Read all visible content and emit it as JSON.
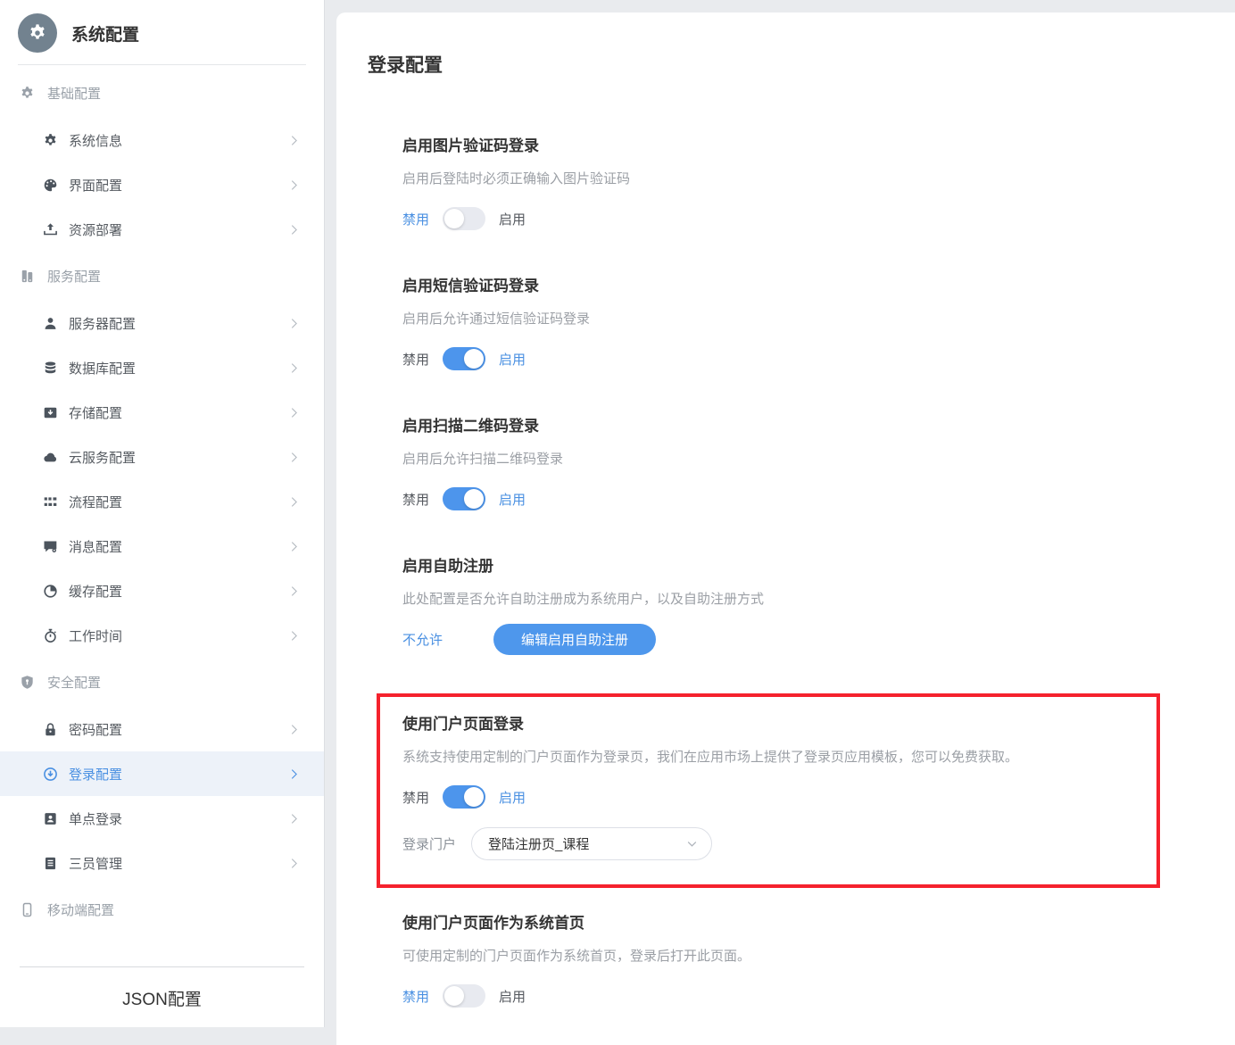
{
  "sidebar": {
    "app_title": "系统配置",
    "app_icon": "app-gear-icon",
    "footer_label": "JSON配置",
    "sections": [
      {
        "label": "基础配置",
        "icon": "gear-icon",
        "items": [
          {
            "label": "系统信息",
            "icon": "gear-icon"
          },
          {
            "label": "界面配置",
            "icon": "palette-icon"
          },
          {
            "label": "资源部署",
            "icon": "deploy-icon"
          }
        ]
      },
      {
        "label": "服务配置",
        "icon": "server-icon",
        "items": [
          {
            "label": "服务器配置",
            "icon": "service-person-icon"
          },
          {
            "label": "数据库配置",
            "icon": "database-icon"
          },
          {
            "label": "存储配置",
            "icon": "storage-icon"
          },
          {
            "label": "云服务配置",
            "icon": "cloud-icon"
          },
          {
            "label": "流程配置",
            "icon": "flow-icon"
          },
          {
            "label": "消息配置",
            "icon": "message-icon"
          },
          {
            "label": "缓存配置",
            "icon": "cache-icon"
          },
          {
            "label": "工作时间",
            "icon": "timer-icon"
          }
        ]
      },
      {
        "label": "安全配置",
        "icon": "shield-icon",
        "items": [
          {
            "label": "密码配置",
            "icon": "lock-icon"
          },
          {
            "label": "登录配置",
            "icon": "login-icon",
            "selected": true
          },
          {
            "label": "单点登录",
            "icon": "sso-icon"
          },
          {
            "label": "三员管理",
            "icon": "roles-icon"
          }
        ]
      },
      {
        "label": "移动端配置",
        "icon": "mobile-icon",
        "items": []
      }
    ]
  },
  "main": {
    "title": "登录配置",
    "toggle_labels": {
      "off": "禁用",
      "on": "启用"
    },
    "settings": [
      {
        "id": "image-captcha-login",
        "title": "启用图片验证码登录",
        "desc": "启用后登陆时必须正确输入图片验证码",
        "control": "toggle",
        "state": "off"
      },
      {
        "id": "sms-captcha-login",
        "title": "启用短信验证码登录",
        "desc": "启用后允许通过短信验证码登录",
        "control": "toggle",
        "state": "on"
      },
      {
        "id": "qrcode-login",
        "title": "启用扫描二维码登录",
        "desc": "启用后允许扫描二维码登录",
        "control": "toggle",
        "state": "on"
      },
      {
        "id": "self-registration",
        "title": "启用自助注册",
        "desc": "此处配置是否允许自助注册成为系统用户，以及自助注册方式",
        "control": "button",
        "status_label": "不允许",
        "button_label": "编辑启用自助注册"
      },
      {
        "id": "portal-page-login",
        "title": "使用门户页面登录",
        "desc": "系统支持使用定制的门户页面作为登录页，我们在应用市场上提供了登录页应用模板，您可以免费获取。",
        "control": "toggle",
        "state": "on",
        "highlighted": true,
        "select": {
          "label": "登录门户",
          "value": "登陆注册页_课程",
          "icon": "chevron-down-icon"
        }
      },
      {
        "id": "portal-page-home",
        "title": "使用门户页面作为系统首页",
        "desc": "可使用定制的门户页面作为系统首页，登录后打开此页面。",
        "control": "toggle",
        "state": "off"
      }
    ],
    "colors": {
      "accent": "#4a90e2",
      "toggle_on": "#4d95ec",
      "toggle_off_track": "#e8eaf0",
      "button": "#4e97ec",
      "highlight_border": "#f5222d",
      "selected_item_bg": "#edf2f9"
    }
  }
}
